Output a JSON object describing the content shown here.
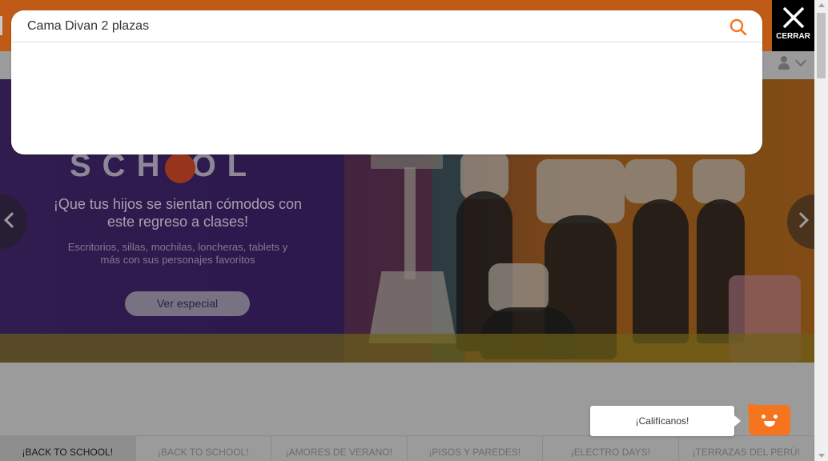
{
  "search": {
    "value": "Cama Divan 2 plazas",
    "icon": "search-icon"
  },
  "close": {
    "label": "CERRAR",
    "icon": "close-icon"
  },
  "hero": {
    "headline": "¡Que tus hijos se sientan cómodos con este regreso a clases!",
    "subtext": "Escritorios, sillas, mochilas, loncheras, tablets y más con sus personajes favoritos",
    "cta_label": "Ver especial"
  },
  "tabs": [
    {
      "label": "¡BACK TO SCHOOL!",
      "active": true
    },
    {
      "label": "¡BACK TO SCHOOL!",
      "active": false
    },
    {
      "label": "¡AMORES DE VERANO!",
      "active": false
    },
    {
      "label": "¡PISOS Y PAREDES!",
      "active": false
    },
    {
      "label": "¡ELECTRO DAYS!",
      "active": false
    },
    {
      "label": "¡TERRAZAS DEL PERÚ!",
      "active": false
    }
  ],
  "rating": {
    "label": "¡Califícanos!"
  },
  "colors": {
    "brand": "#f5741e",
    "close_bg": "#000000"
  }
}
